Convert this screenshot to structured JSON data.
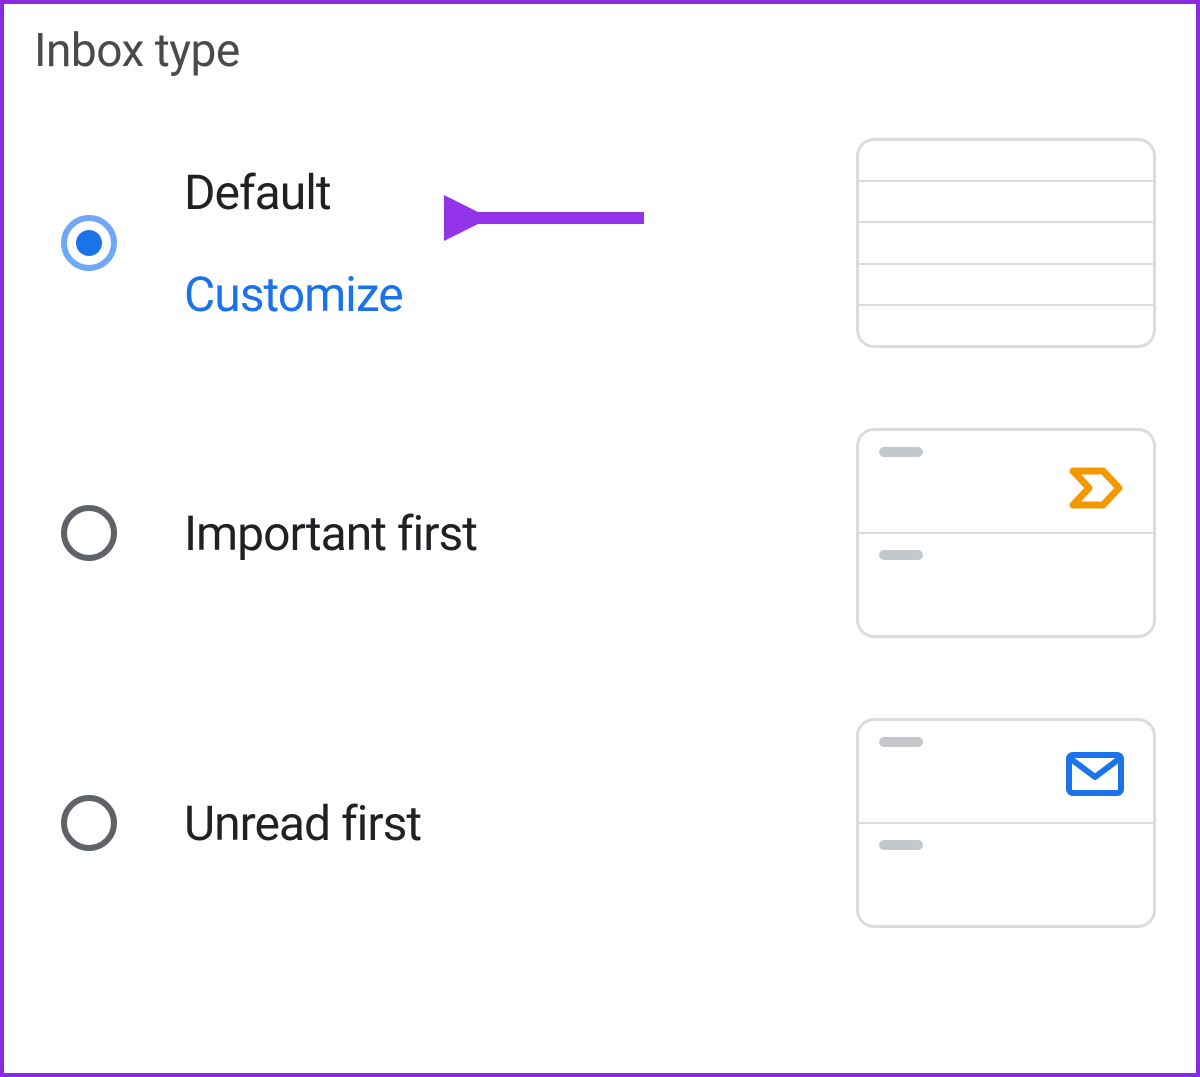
{
  "section_title": "Inbox type",
  "options": [
    {
      "label": "Default",
      "customize_label": "Customize",
      "selected": true,
      "preview_type": "lines"
    },
    {
      "label": "Important first",
      "selected": false,
      "preview_type": "important"
    },
    {
      "label": "Unread first",
      "selected": false,
      "preview_type": "unread"
    }
  ],
  "colors": {
    "accent_blue": "#1a73e8",
    "important_orange": "#f29900",
    "border_gray": "#dadce0",
    "text_primary": "#202124",
    "text_secondary": "#5f6368",
    "annotation_purple": "#8a2be2"
  }
}
